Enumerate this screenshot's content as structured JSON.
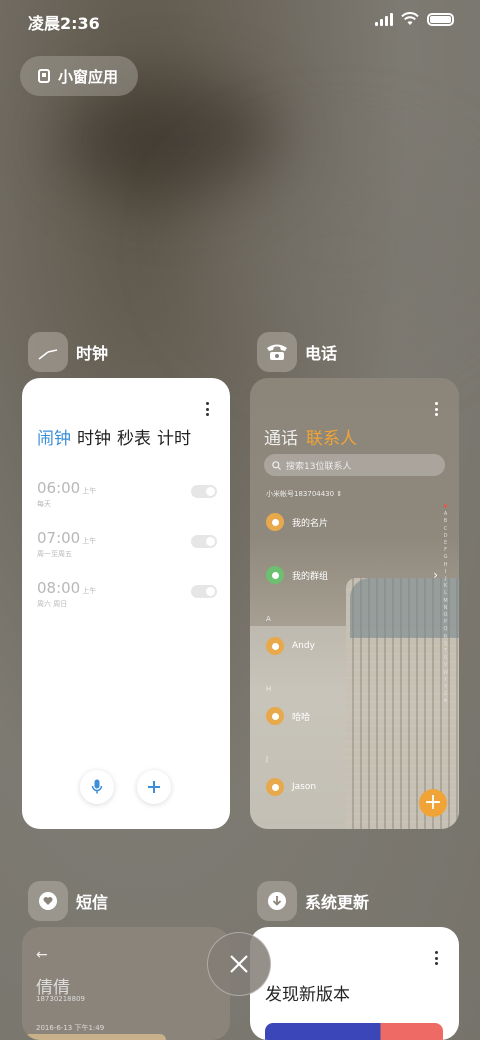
{
  "status_bar": {
    "time": "凌晨2:36"
  },
  "floating_window_button": {
    "label": "小窗应用"
  },
  "apps": {
    "clock": {
      "name": "时钟",
      "tabs": [
        "闹钟",
        "时钟",
        "秒表",
        "计时"
      ],
      "active_tab": "闹钟",
      "alarms": [
        {
          "time": "06:00",
          "ampm": "上午",
          "repeat": "每天",
          "enabled": false
        },
        {
          "time": "07:00",
          "ampm": "上午",
          "repeat": "周一至周五",
          "enabled": false
        },
        {
          "time": "08:00",
          "ampm": "上午",
          "repeat": "周六 周日",
          "enabled": false
        }
      ]
    },
    "phone": {
      "name": "电话",
      "tabs": [
        "通话",
        "联系人"
      ],
      "active_tab": "联系人",
      "search_placeholder": "搜索13位联系人",
      "account": "小米帐号183704430",
      "my_card": "我的名片",
      "my_groups": "我的群组",
      "sections": [
        {
          "letter": "A",
          "contacts": [
            "Andy"
          ]
        },
        {
          "letter": "H",
          "contacts": [
            "哈哈"
          ]
        },
        {
          "letter": "J",
          "contacts": [
            "Jason"
          ]
        }
      ],
      "alpha_index": [
        "♥",
        "A",
        "B",
        "C",
        "D",
        "E",
        "F",
        "G",
        "H",
        "I",
        "J",
        "K",
        "L",
        "M",
        "N",
        "O",
        "P",
        "Q",
        "R",
        "S",
        "T",
        "U",
        "V",
        "W",
        "X",
        "Y",
        "Z",
        "#"
      ]
    },
    "sms": {
      "name": "短信",
      "contact_name": "倩倩",
      "contact_number": "18730218809",
      "date": "2016-6-13 下午1:49"
    },
    "update": {
      "name": "系统更新",
      "title": "发现新版本"
    }
  },
  "colors": {
    "clock_accent": "#3a8fd8",
    "phone_accent": "#f0a437",
    "avatar_orange": "#e8a94c",
    "avatar_green": "#6cc070"
  }
}
